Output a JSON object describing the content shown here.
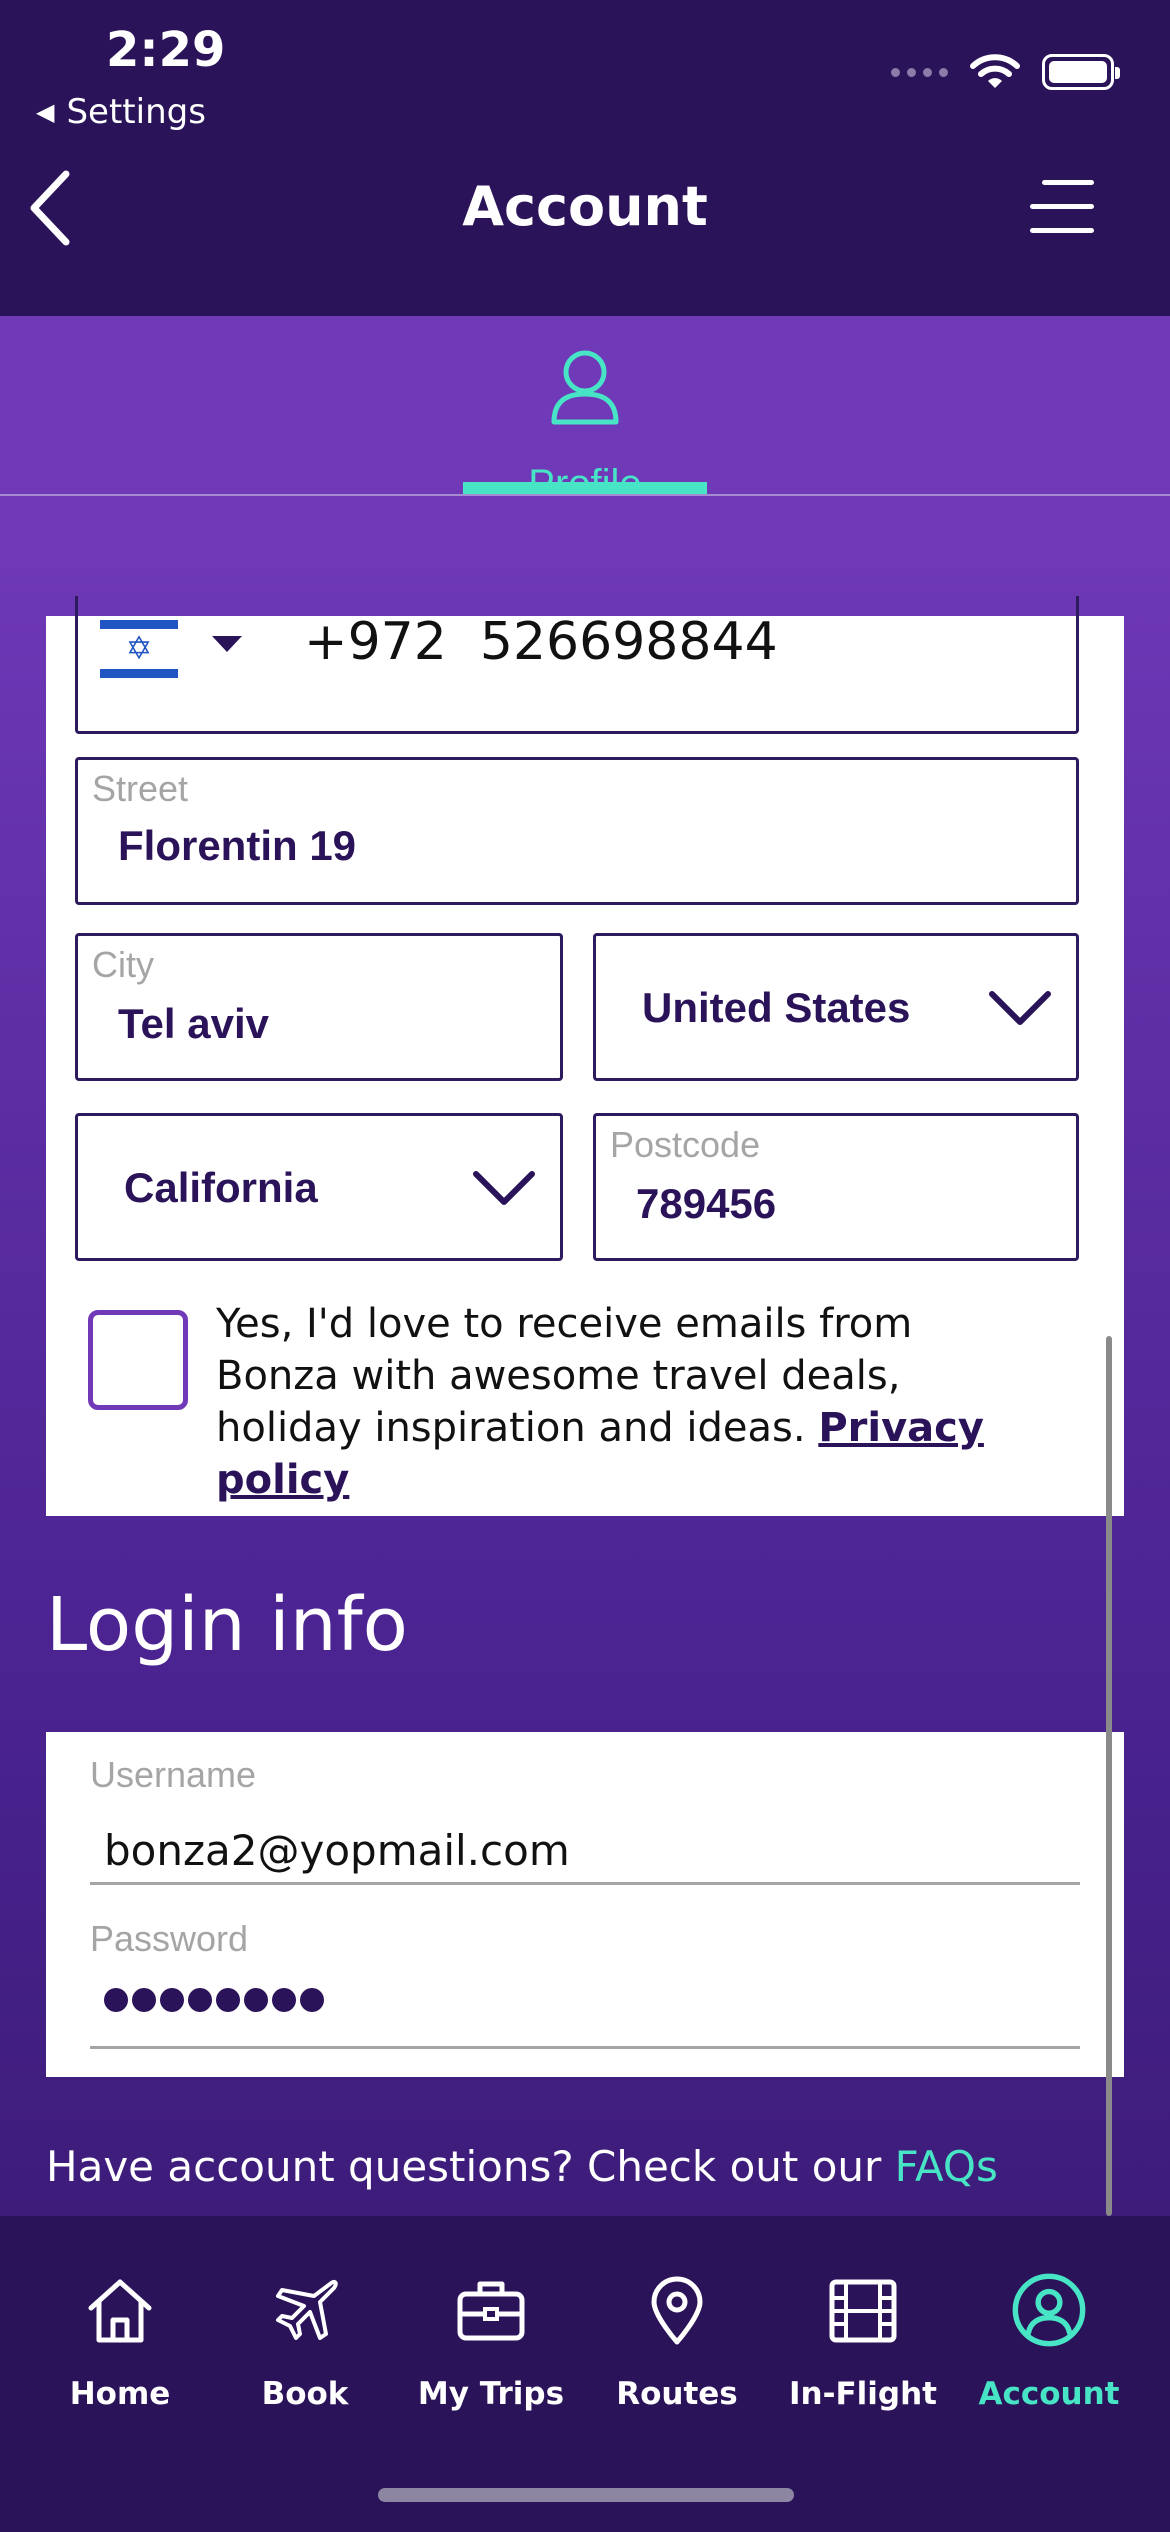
{
  "status": {
    "time": "2:29",
    "back_label": "Settings"
  },
  "nav": {
    "title": "Account"
  },
  "tabs": {
    "profile_label": "Profile"
  },
  "contact": {
    "flag_icon": "israel-flag-icon",
    "country_code": "+972",
    "phone": "526698844"
  },
  "address": {
    "street_label": "Street",
    "street_value": "Florentin 19",
    "city_label": "City",
    "city_value": "Tel aviv",
    "country_value": "United States",
    "state_value": "California",
    "postcode_label": "Postcode",
    "postcode_value": "789456"
  },
  "consent": {
    "text": "Yes, I'd love to receive emails from Bonza with awesome travel deals, holiday inspiration and ideas. ",
    "link": "Privacy policy",
    "checked": false
  },
  "login": {
    "title": "Login info",
    "username_label": "Username",
    "username_value": "bonza2@yopmail.com",
    "password_label": "Password",
    "password_mask": "••••••••"
  },
  "footer": {
    "faq_text": "Have account questions? Check out our ",
    "faq_link": "FAQs"
  },
  "tabbar": [
    {
      "label": "Home",
      "icon": "home-icon"
    },
    {
      "label": "Book",
      "icon": "plane-icon"
    },
    {
      "label": "My Trips",
      "icon": "briefcase-icon"
    },
    {
      "label": "Routes",
      "icon": "location-pin-icon"
    },
    {
      "label": "In-Flight",
      "icon": "film-icon"
    },
    {
      "label": "Account",
      "icon": "account-icon",
      "active": true
    }
  ],
  "colors": {
    "brand_dark": "#2a1358",
    "brand_purple": "#7039b8",
    "accent": "#47e5c6"
  }
}
